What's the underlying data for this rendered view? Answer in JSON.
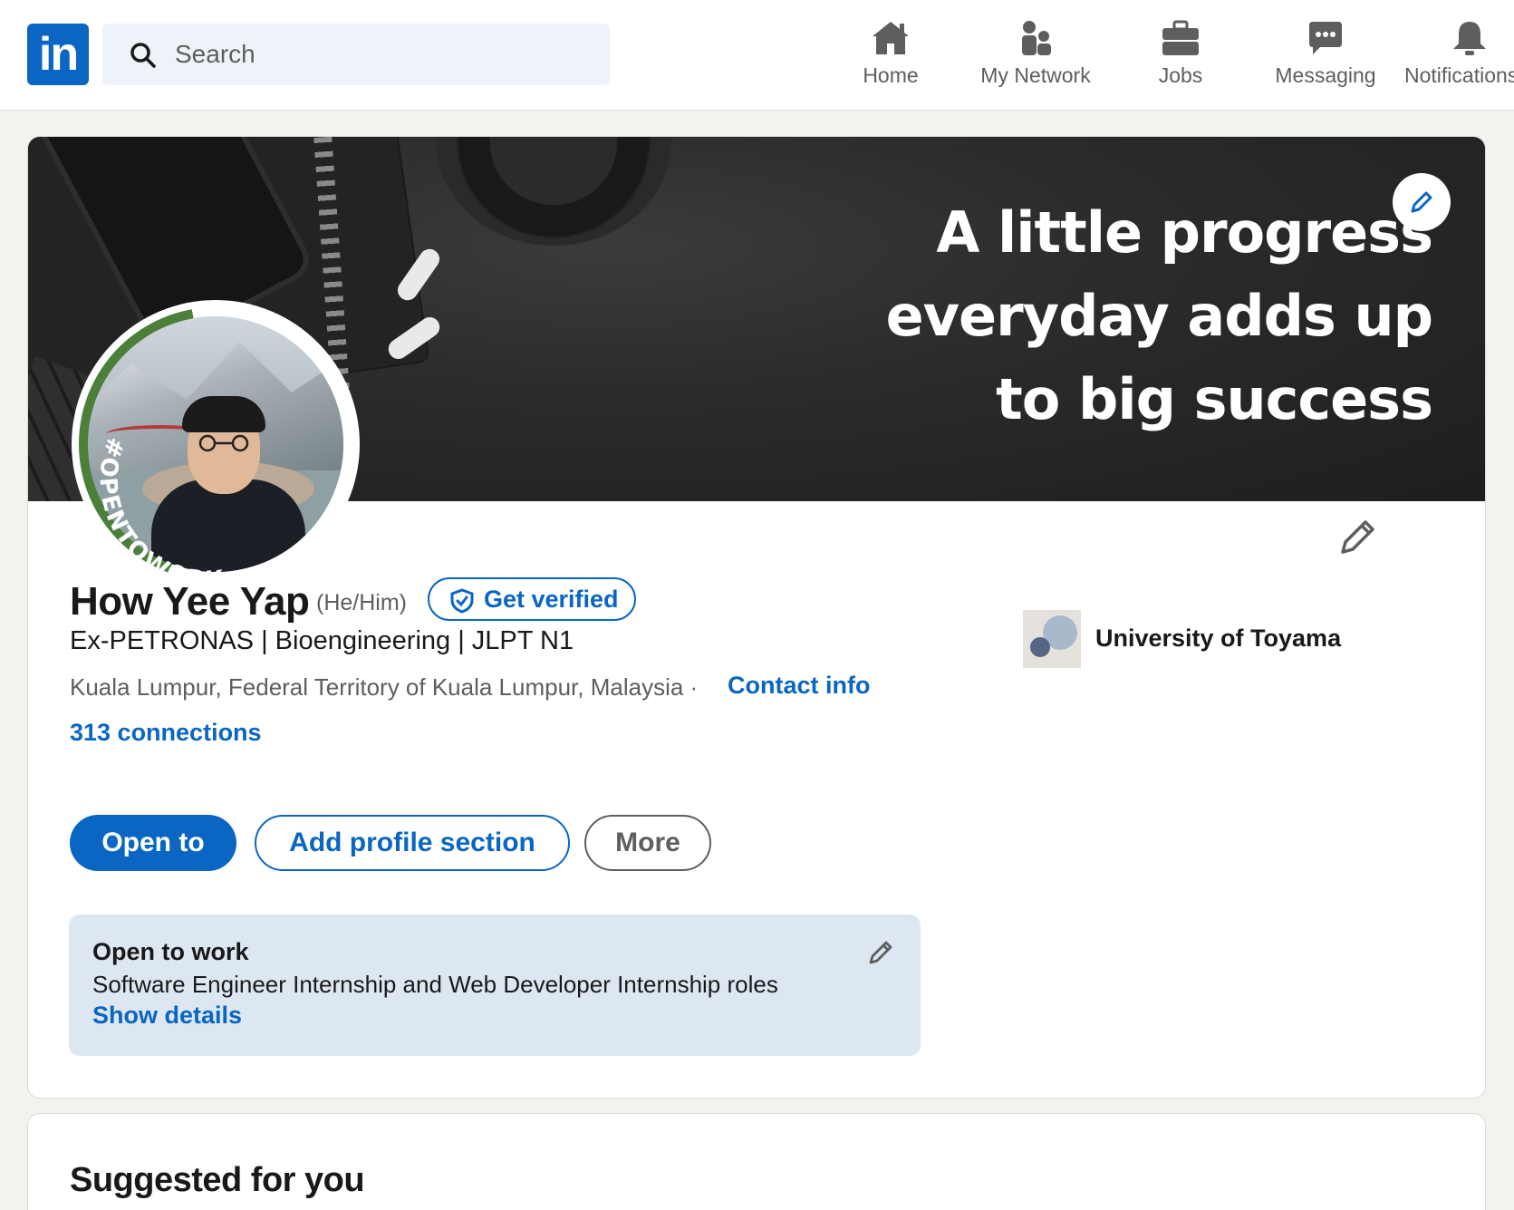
{
  "nav": {
    "logo_text": "in",
    "search_placeholder": "Search",
    "items": [
      {
        "label": "Home",
        "icon": "home-icon"
      },
      {
        "label": "My Network",
        "icon": "network-icon"
      },
      {
        "label": "Jobs",
        "icon": "jobs-icon"
      },
      {
        "label": "Messaging",
        "icon": "messaging-icon"
      },
      {
        "label": "Notifications",
        "icon": "bell-icon"
      }
    ]
  },
  "banner": {
    "lines": [
      "A little progress",
      "everyday adds up",
      "to big success"
    ]
  },
  "avatar": {
    "badge_text": "#OPENTOWORK"
  },
  "profile": {
    "name": "How Yee Yap",
    "pronouns": "(He/Him)",
    "verify_label": "Get verified",
    "headline": "Ex-PETRONAS | Bioengineering | JLPT N1",
    "location": "Kuala Lumpur, Federal Territory of Kuala Lumpur, Malaysia ·",
    "contact_label": "Contact info",
    "connections": "313 connections"
  },
  "actions": {
    "open_to": "Open to",
    "add_section": "Add profile section",
    "more": "More"
  },
  "education": {
    "name": "University of Toyama"
  },
  "open_to_work": {
    "title": "Open to work",
    "description": "Software Engineer Internship and Web Developer Internship roles",
    "link": "Show details"
  },
  "suggested": {
    "title": "Suggested for you"
  },
  "colors": {
    "brand": "#0a66c2",
    "open_to_work_green": "#4b7f3a",
    "page_background": "#f4f2ee"
  }
}
